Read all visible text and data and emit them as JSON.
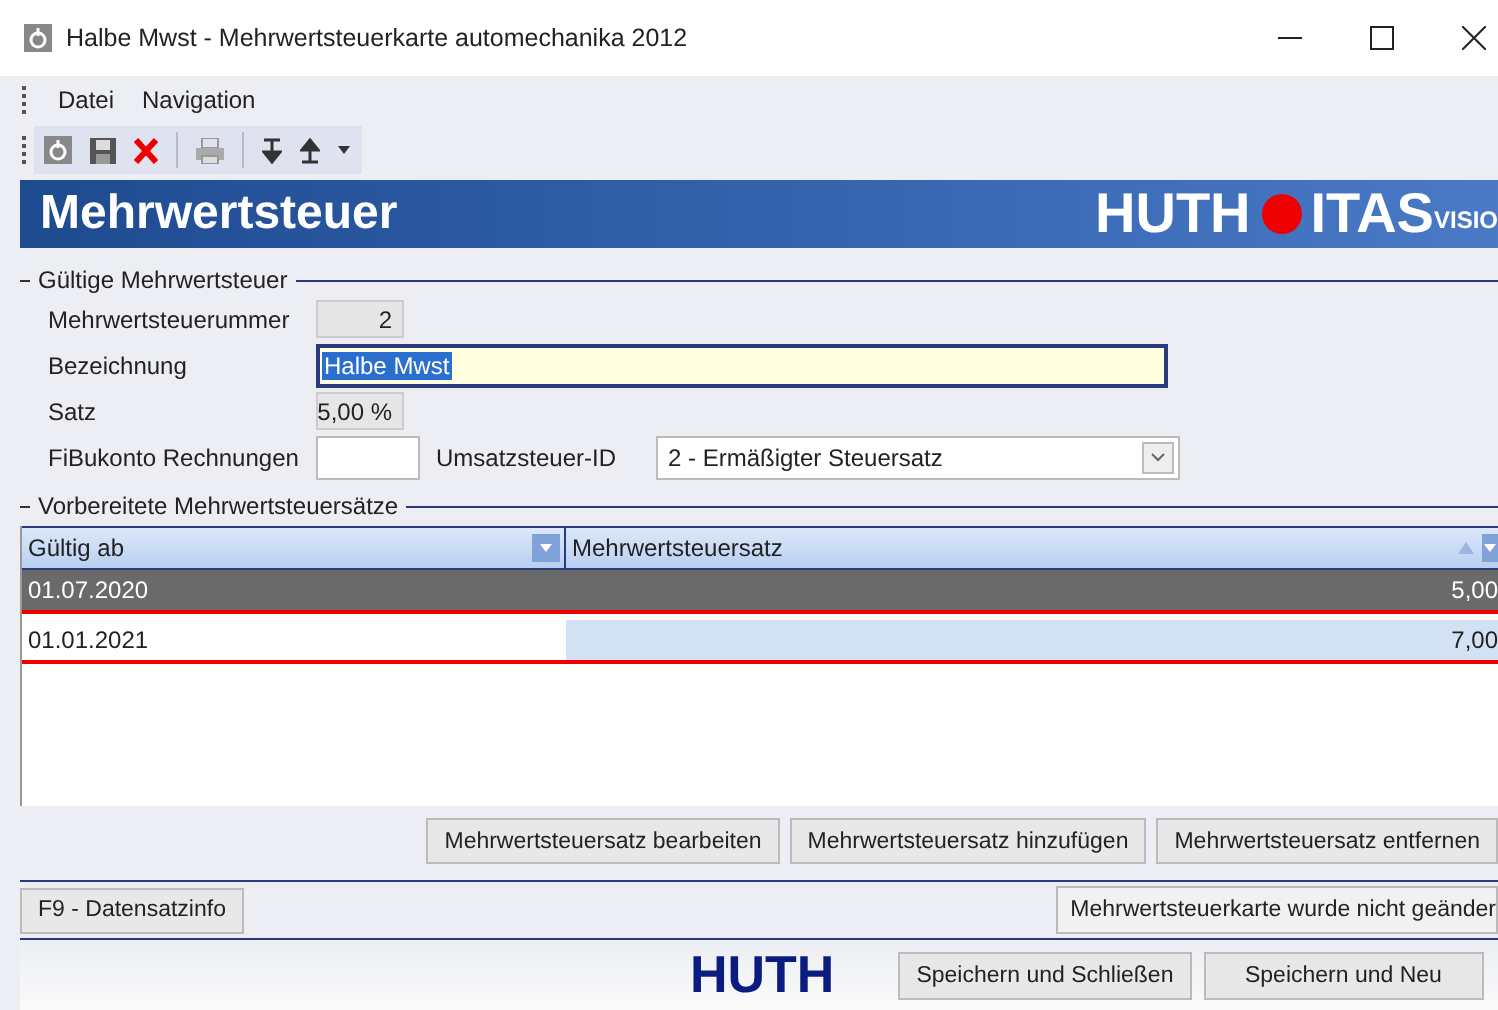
{
  "window": {
    "title": "Halbe Mwst - Mehrwertsteuerkarte automechanika 2012"
  },
  "menu": [
    "Datei",
    "Navigation"
  ],
  "banner": {
    "title": "Mehrwertsteuer",
    "logo_left": "HUTH",
    "logo_right": "ITAS",
    "logo_sub": "VISIO"
  },
  "current_group": {
    "legend": "Gültige Mehrwertsteuer",
    "number": {
      "label": "Mehrwertsteuerummer",
      "value": "2"
    },
    "name": {
      "label": "Bezeichnung",
      "value": "Halbe Mwst"
    },
    "rate": {
      "label": "Satz",
      "value": "5,00 %"
    },
    "account": {
      "label": "FiBukonto Rechnungen"
    },
    "tax_id": {
      "label": "Umsatzsteuer-ID",
      "value": "2 - Ermäßigter Steuersatz"
    }
  },
  "prepared_group": {
    "legend": "Vorbereitete Mehrwertsteuersätze",
    "columns": [
      "Gültig ab",
      "Mehrwertsteuersatz"
    ],
    "rows": [
      {
        "valid_from": "01.07.2020",
        "rate": "5,00",
        "selected": true
      },
      {
        "valid_from": "01.01.2021",
        "rate": "7,00",
        "selected": false
      }
    ]
  },
  "table_buttons": [
    "Mehrwertsteuersatz bearbeiten",
    "Mehrwertsteuersatz hinzufügen",
    "Mehrwertsteuersatz entfernen"
  ],
  "record_info_button": "F9 - Datensatzinfo",
  "status": "Mehrwertsteuerkarte wurde nicht geänder",
  "footer_logo": "HUTH",
  "footer_buttons": [
    "Speichern und Schließen",
    "Speichern und Neu"
  ]
}
